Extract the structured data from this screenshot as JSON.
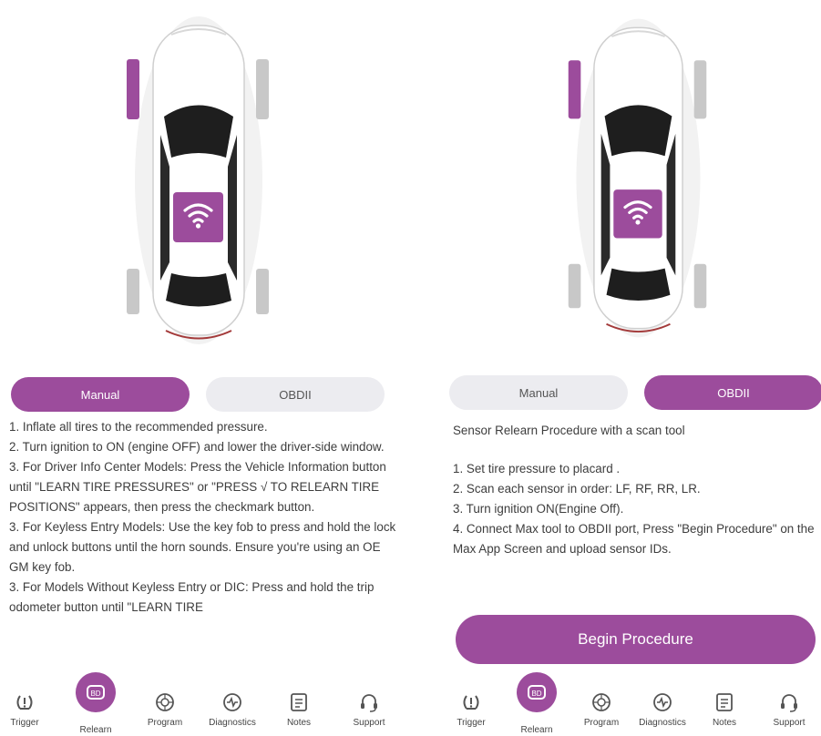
{
  "colors": {
    "accent": "#9c4c9c",
    "inactive_tab": "#ececf0"
  },
  "left_panel": {
    "tabs": [
      {
        "label": "Manual",
        "active": true
      },
      {
        "label": "OBDII",
        "active": false
      }
    ],
    "steps": [
      "1. Inflate all tires to the recommended pressure.",
      "2. Turn ignition to ON (engine OFF) and lower the driver-side window.",
      "3. For Driver Info Center Models: Press the Vehicle Information button until \"LEARN TIRE PRESSURES\" or \"PRESS √ TO RELEARN TIRE POSITIONS\" appears, then press the checkmark button.",
      "3. For Keyless Entry Models: Use the key fob to press and hold the lock and unlock buttons until the horn sounds. Ensure you're using an OE GM key fob.",
      "3. For Models Without Keyless Entry or DIC: Press and hold the trip odometer button until \"LEARN TIRE"
    ]
  },
  "right_panel": {
    "tabs": [
      {
        "label": "Manual",
        "active": false
      },
      {
        "label": "OBDII",
        "active": true
      }
    ],
    "subtitle": "Sensor Relearn Procedure with a scan tool",
    "steps": [
      "1. Set tire pressure to placard .",
      "2. Scan each sensor in order: LF, RF, RR, LR.",
      "3. Turn ignition ON(Engine Off).",
      "4. Connect Max tool to OBDII port, Press \"Begin Procedure\" on the Max App Screen and upload sensor IDs."
    ],
    "begin_button": "Begin Procedure"
  },
  "nav": {
    "items": [
      {
        "label": "Trigger",
        "icon": "tpms-icon"
      },
      {
        "label": "Relearn",
        "icon": "obd-icon",
        "active": true
      },
      {
        "label": "Program",
        "icon": "tire-icon"
      },
      {
        "label": "Diagnostics",
        "icon": "pulse-icon"
      },
      {
        "label": "Notes",
        "icon": "notes-icon"
      },
      {
        "label": "Support",
        "icon": "headset-icon"
      }
    ]
  }
}
